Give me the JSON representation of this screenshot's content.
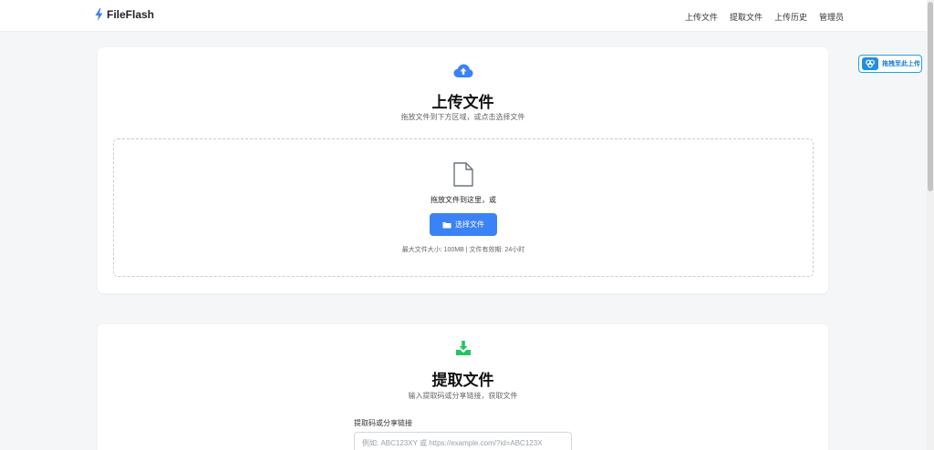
{
  "app": {
    "brand": "FileFlash",
    "brand_icon": "lightning-icon",
    "brand_icon_color": "#3b82f6"
  },
  "nav": {
    "items": [
      {
        "label": "上传文件"
      },
      {
        "label": "提取文件"
      },
      {
        "label": "上传历史"
      },
      {
        "label": "管理员"
      }
    ]
  },
  "floating_button": {
    "label": "拖拽至此上传",
    "icon": "clover-icon"
  },
  "upload": {
    "icon": "cloud-upload-icon",
    "title": "上传文件",
    "subtitle": "拖放文件到下方区域，或点击选择文件",
    "dropzone": {
      "icon": "file-icon",
      "text": "拖放文件到这里，或",
      "button_label": "选择文件",
      "button_icon": "folder-icon",
      "limits": "最大文件大小: 100MB | 文件有效期: 24小时"
    }
  },
  "extract": {
    "icon": "download-icon",
    "title": "提取文件",
    "subtitle": "输入提取码或分享链接，获取文件",
    "field_label": "提取码或分享链接",
    "field_value": "",
    "field_placeholder": "例如: ABC123XY 或 https://example.com/?id=ABC123X"
  },
  "colors": {
    "primary": "#3b82f6",
    "success": "#22c55e",
    "accent_blue": "#1f8ee8"
  }
}
